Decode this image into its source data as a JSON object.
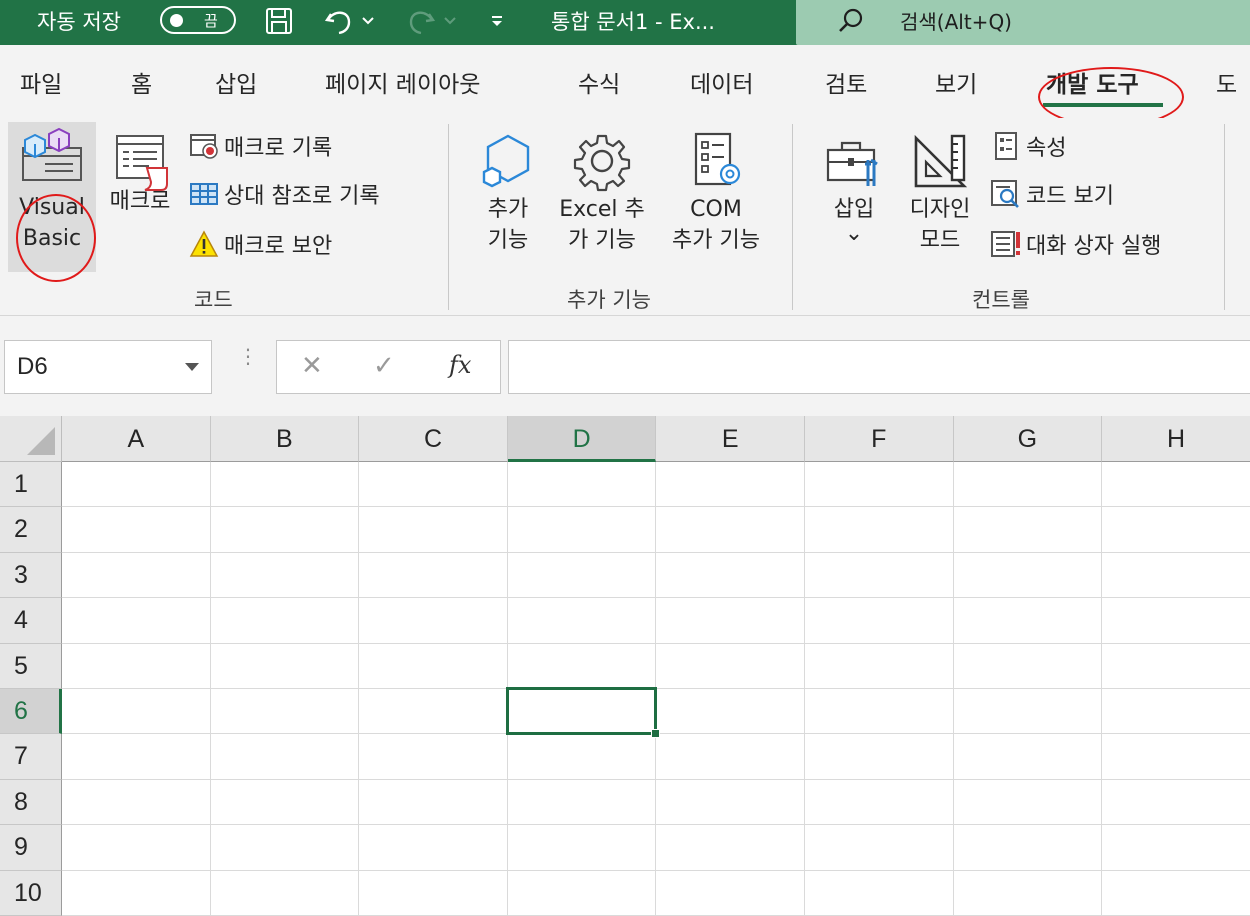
{
  "titlebar": {
    "autosave_label": "자동 저장",
    "autosave_state": "끔",
    "doc_title": "통합 문서1  -  Ex...",
    "search_placeholder": "검색(Alt+Q)"
  },
  "tabs": [
    "파일",
    "홈",
    "삽입",
    "페이지 레이아웃",
    "수식",
    "데이터",
    "검토",
    "보기",
    "개발 도구",
    "도"
  ],
  "active_tab": "개발 도구",
  "ribbon": {
    "code": {
      "label": "코드",
      "visual_basic_line1": "Visual",
      "visual_basic_line2": "Basic",
      "macros": "매크로",
      "record_macro": "매크로 기록",
      "relative_ref": "상대 참조로 기록",
      "macro_security": "매크로 보안"
    },
    "addins": {
      "label": "추가 기능",
      "addins_line1": "추가",
      "addins_line2": "기능",
      "excel_addins_line1": "Excel 추",
      "excel_addins_line2": "가 기능",
      "com_addins_line1": "COM",
      "com_addins_line2": "추가 기능"
    },
    "controls": {
      "label": "컨트롤",
      "insert_line1": "삽입",
      "insert_line2": "⌄",
      "design_mode_line1": "디자인",
      "design_mode_line2": "모드",
      "properties": "속성",
      "view_code": "코드 보기",
      "run_dialog": "대화 상자 실행"
    }
  },
  "formula_bar": {
    "name_box": "D6",
    "cancel": "✕",
    "enter": "✓",
    "fx": "fx",
    "formula": ""
  },
  "sheet": {
    "columns": [
      "A",
      "B",
      "C",
      "D",
      "E",
      "F",
      "G",
      "H"
    ],
    "rows": [
      "1",
      "2",
      "3",
      "4",
      "5",
      "6",
      "7",
      "8",
      "9",
      "10"
    ],
    "selected_column": "D",
    "selected_row": "6"
  },
  "colors": {
    "accent": "#217346",
    "annotation": "#e01a1a",
    "ribbon_bg": "#f3f3f3"
  }
}
